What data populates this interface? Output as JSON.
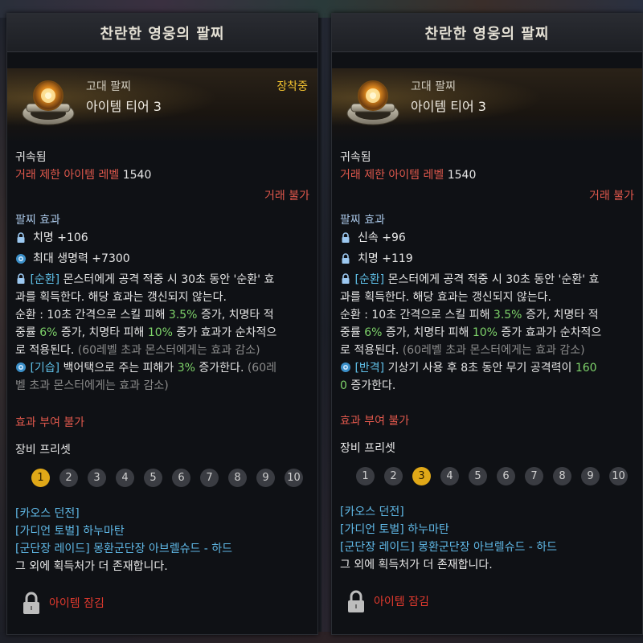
{
  "colors": {
    "accent_gold": "#f2c230",
    "restriction_red": "#e0584c",
    "effect_title_blue": "#a9c6e6",
    "highlight_green": "#7ed36a",
    "source_cyan": "#5fb8e6",
    "lock_red": "#e33a2e"
  },
  "left": {
    "title": "찬란한 영웅의 팔찌",
    "grade": "고대 팔찌",
    "tier": "아이템 티어 3",
    "equipped": "장착중",
    "bound": "귀속됨",
    "trade_limit_label": "거래 제한 아이템 레벨",
    "trade_limit_value": "1540",
    "trade_unavailable": "거래 불가",
    "effect_header": "팔찌 효과",
    "stats": [
      {
        "icon": "lock-icon",
        "text": "치명 +106"
      },
      {
        "icon": "gear-icon",
        "text": "최대 생명력 +7300"
      }
    ],
    "effect1": {
      "icon": "lock-icon",
      "tag": "[순환]",
      "line1": " 몬스터에게 공격 적중 시 30초 동안 '순환' 효",
      "line2": "과를 획득한다. 해당 효과는 갱신되지 않는다.",
      "line3a": "순환 : 10초 간격으로 스킬 피해 ",
      "line3b": "3.5%",
      "line3c": " 증가, 치명타 적",
      "line4a": "중률 ",
      "line4b": "6%",
      "line4c": " 증가, 치명타 피해 ",
      "line4d": "10%",
      "line4e": " 증가 효과가 순차적으",
      "line5a": "로 적용된다. ",
      "line5b": "(60레벨 초과 몬스터에게는 효과 감소)"
    },
    "effect2": {
      "icon": "gear-icon",
      "tag": "[기습]",
      "line1a": " 백어택으로 주는 피해가 ",
      "line1b": "3%",
      "line1c": " 증가한다. ",
      "line1d": "(60레",
      "line2": "벨 초과 몬스터에게는 효과 감소)"
    },
    "no_effect_grant": "효과 부여 불가",
    "preset_label": "장비 프리셋",
    "presets": [
      "1",
      "2",
      "3",
      "4",
      "5",
      "6",
      "7",
      "8",
      "9",
      "10"
    ],
    "active_preset": 0,
    "sources": [
      "[카오스 던전]",
      "[가디언 토벌] 하누마탄",
      "[군단장 레이드] 몽환군단장 아브렐슈드 - 하드"
    ],
    "more_sources": "그 외에 획득처가 더 존재합니다.",
    "lock_label": "아이템 잠김"
  },
  "right": {
    "title": "찬란한 영웅의 팔찌",
    "grade": "고대 팔찌",
    "tier": "아이템 티어 3",
    "bound": "귀속됨",
    "trade_limit_label": "거래 제한 아이템 레벨",
    "trade_limit_value": "1540",
    "trade_unavailable": "거래 불가",
    "effect_header": "팔찌 효과",
    "stats": [
      {
        "icon": "lock-icon",
        "text": "신속 +96"
      },
      {
        "icon": "lock-icon",
        "text": "치명 +119"
      }
    ],
    "effect1": {
      "icon": "lock-icon",
      "tag": "[순환]",
      "line1": " 몬스터에게 공격 적중 시 30초 동안 '순환' 효",
      "line2": "과를 획득한다. 해당 효과는 갱신되지 않는다.",
      "line3a": "순환 : 10초 간격으로 스킬 피해 ",
      "line3b": "3.5%",
      "line3c": " 증가, 치명타 적",
      "line4a": "중률 ",
      "line4b": "6%",
      "line4c": " 증가, 치명타 피해 ",
      "line4d": "10%",
      "line4e": " 증가 효과가 순차적으",
      "line5a": "로 적용된다. ",
      "line5b": "(60레벨 초과 몬스터에게는 효과 감소)"
    },
    "effect2": {
      "icon": "gear-icon",
      "tag": "[반격]",
      "line1a": " 기상기 사용 후 8초 동안 무기 공격력이 ",
      "line1b": "160",
      "line2a": "0",
      "line2b": " 증가한다."
    },
    "no_effect_grant": "효과 부여 불가",
    "preset_label": "장비 프리셋",
    "presets": [
      "1",
      "2",
      "3",
      "4",
      "5",
      "6",
      "7",
      "8",
      "9",
      "10"
    ],
    "active_preset": 2,
    "sources": [
      "[카오스 던전]",
      "[가디언 토벌] 하누마탄",
      "[군단장 레이드] 몽환군단장 아브렐슈드 - 하드"
    ],
    "more_sources": "그 외에 획득처가 더 존재합니다.",
    "lock_label": "아이템 잠김"
  }
}
